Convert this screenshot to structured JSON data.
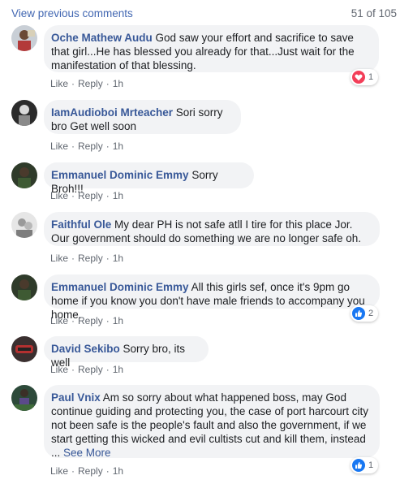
{
  "header": {
    "view_previous": "View previous comments",
    "count": "51 of 105"
  },
  "actions": {
    "like": "Like",
    "reply": "Reply",
    "dot": "·"
  },
  "colors": {
    "link": "#385898",
    "love": "#f33e58",
    "like": "#1877f2"
  },
  "comments": [
    {
      "author": "Oche Mathew Audu",
      "text": " God saw your effort and sacrifice to save that girl...He has blessed you already for that...Just wait for the manifestation of that blessing.",
      "time": "1h",
      "reaction": {
        "icon": "love-icon",
        "count": "1"
      }
    },
    {
      "author": "IamAudioboi Mrteacher",
      "text": " Sori sorry bro Get well soon",
      "time": "1h"
    },
    {
      "author": "Emmanuel Dominic Emmy",
      "text": " Sorry Broh!!!",
      "time": "1h"
    },
    {
      "author": "Faithful Ole",
      "text": " My dear PH is not safe atll I tire for this place Jor. Our government should do something we are no longer safe oh.",
      "time": "1h"
    },
    {
      "author": "Emmanuel Dominic Emmy",
      "text": " All this girls sef, once it's 9pm go home if you know you don't have male friends to accompany you home.",
      "time": "1h",
      "reaction": {
        "icon": "like-icon",
        "count": "2"
      }
    },
    {
      "author": "David Sekibo",
      "text": " Sorry bro, its well",
      "time": "1h"
    },
    {
      "author": "Paul Vnix",
      "text": " Am so sorry about what happened boss, may God continue guiding and protecting you, the case of port harcourt city not been safe is the people's fault and also the government, if we start getting this wicked and evil cultists cut and kill them, instead ...",
      "see_more": " See More",
      "time": "1h",
      "reaction": {
        "icon": "like-icon",
        "count": "1"
      }
    }
  ]
}
